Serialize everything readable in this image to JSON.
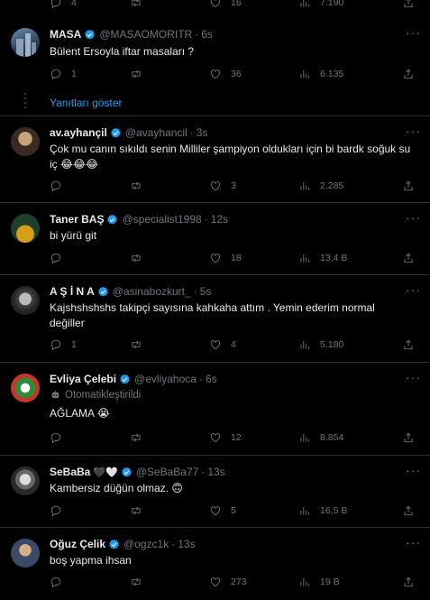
{
  "top_partial": {
    "reply_count": "4",
    "retweet_count": "",
    "like_count": "16",
    "view_count": "7.190"
  },
  "show_replies_label": "Yanıtları göster",
  "tweets": [
    {
      "name": "MASA",
      "handle": "@MASAOMORITR",
      "time": "6s",
      "text": "Bülent Ersoyla iftar masaları ?",
      "reply_count": "1",
      "retweet_count": "",
      "like_count": "36",
      "view_count": "6.135"
    },
    {
      "name": "av.ayhançil",
      "handle": "@avayhancil",
      "time": "3s",
      "text": "Çok mu canın sıkıldı senin Milliler şampiyon oldukları için bi bardk soğuk su iç",
      "emoji": "😂😂😂",
      "reply_count": "",
      "retweet_count": "",
      "like_count": "3",
      "view_count": "2.285"
    },
    {
      "name": "Taner BAŞ",
      "handle": "@specialist1998",
      "time": "12s",
      "text": "bi yürü git",
      "reply_count": "",
      "retweet_count": "",
      "like_count": "18",
      "view_count": "13,4 B"
    },
    {
      "name": "A Ş İ N A",
      "handle": "@asinabozkurt_",
      "time": "5s",
      "text": "Kajshshshshs takipçi sayısına kahkaha attım . Yemin ederim normal değiller",
      "reply_count": "1",
      "retweet_count": "",
      "like_count": "4",
      "view_count": "5.180"
    },
    {
      "name": "Evliya Çelebi",
      "handle": "@evliyahoca",
      "time": "6s",
      "automated_label": "Otomatikleştirildi",
      "text": "AĞLAMA",
      "emoji": "😭",
      "reply_count": "",
      "retweet_count": "",
      "like_count": "12",
      "view_count": "8.854"
    },
    {
      "name": "SeBaBa",
      "name_suffix": "🖤🤍",
      "handle": "@SeBaBa77",
      "time": "13s",
      "text": "Kambersiz düğün olmaz.",
      "emoji": "🙃",
      "reply_count": "",
      "retweet_count": "",
      "like_count": "5",
      "view_count": "16,5 B"
    },
    {
      "name": "Oğuz Çelik",
      "handle": "@ogzc1k",
      "time": "13s",
      "text": "boş yapma ihsan",
      "reply_count": "",
      "retweet_count": "",
      "like_count": "273",
      "view_count": "19 B"
    }
  ],
  "colors": {
    "background": "#000000",
    "text": "#e7e9ea",
    "muted": "#71767b",
    "link": "#1d9bf0",
    "verified": "#1d9bf0",
    "divider": "#2f3336"
  }
}
